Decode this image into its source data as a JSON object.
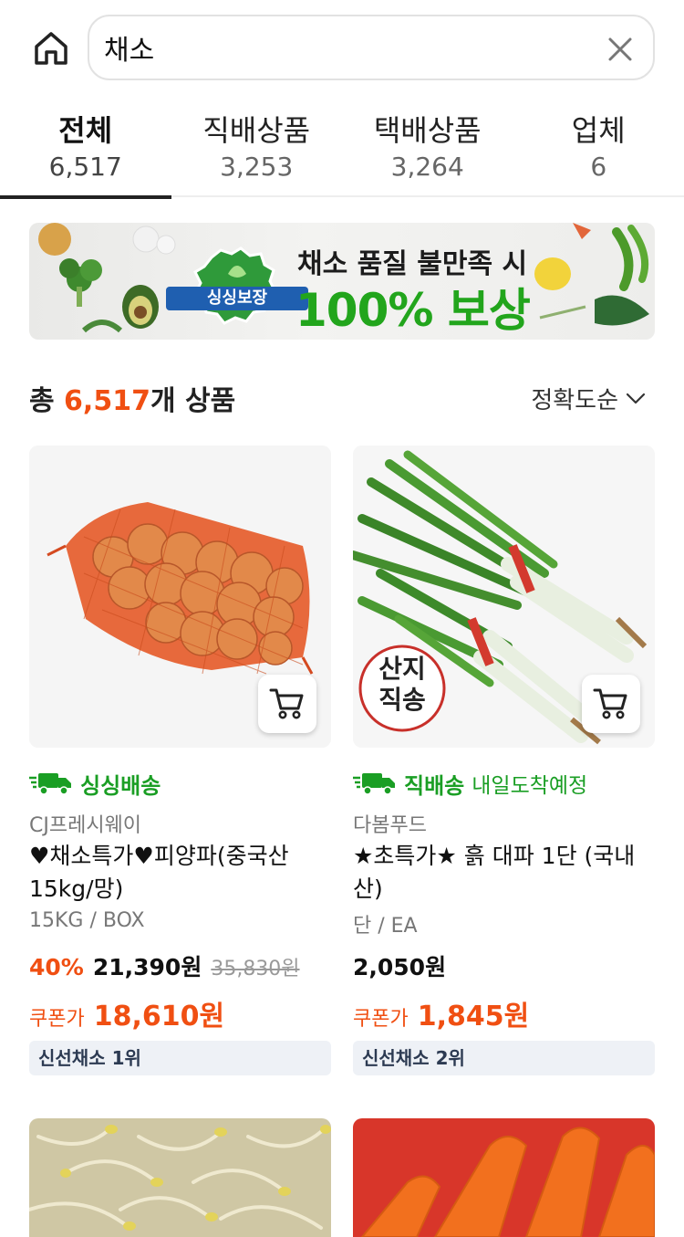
{
  "search": {
    "query": "채소"
  },
  "tabs": [
    {
      "label": "전체",
      "count": "6,517"
    },
    {
      "label": "직배상품",
      "count": "3,253"
    },
    {
      "label": "택배상품",
      "count": "3,264"
    },
    {
      "label": "업체",
      "count": "6"
    }
  ],
  "banner": {
    "badge": "싱싱보장",
    "line1": "채소 품질 불만족 시",
    "line2": "100% 보상"
  },
  "summary": {
    "prefix": "총 ",
    "count": "6,517",
    "suffix": "개 상품",
    "sort_label": "정확도순"
  },
  "products": [
    {
      "delivery_label": "싱싱배송",
      "delivery_sub": "",
      "seller": "CJ프레시웨이",
      "name": "♥채소특가♥피양파(중국산 15kg/망)",
      "unit": "15KG / BOX",
      "discount": "40%",
      "price": "21,390원",
      "original_price": "35,830원",
      "coupon_label": "쿠폰가",
      "coupon_price": "18,610원",
      "rank": "신선채소 1위",
      "image_icon": "onion-net-bag"
    },
    {
      "delivery_label": "직배송",
      "delivery_sub": "내일도착예정",
      "seller": "다봄푸드",
      "name": "★초특가★ 흙 대파 1단 (국내산)",
      "unit": "단 / EA",
      "discount": "",
      "price": "2,050원",
      "original_price": "",
      "coupon_label": "쿠폰가",
      "coupon_price": "1,845원",
      "rank": "신선채소 2위",
      "stamp_line1": "산지",
      "stamp_line2": "직송",
      "image_icon": "green-onion-bundle"
    }
  ],
  "colors": {
    "accent_orange": "#f04f12",
    "delivery_green": "#1a9e24",
    "banner_green": "#22a51c"
  }
}
